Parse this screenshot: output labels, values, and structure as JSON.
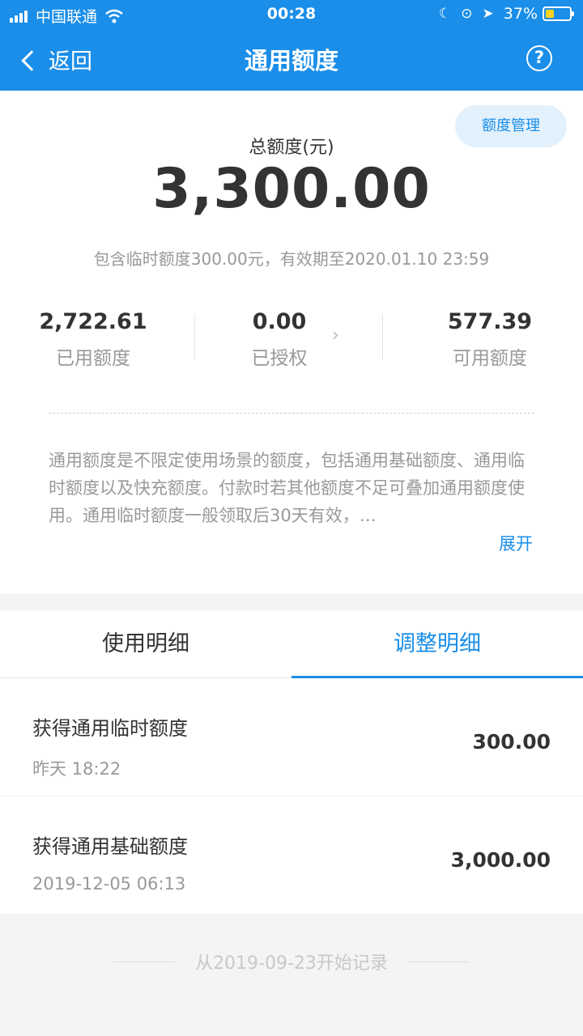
{
  "status": {
    "carrier": "中国联通",
    "time": "00:28",
    "battery": "37%",
    "colors": {
      "battery_fill": "#ffd21f"
    }
  },
  "nav": {
    "back_label": "返回",
    "title": "通用额度",
    "help_glyph": "?"
  },
  "summary": {
    "manage_label": "额度管理",
    "total_label": "总额度(元)",
    "total": "3,300.00",
    "note": "包含临时额度300.00元，有效期至2020.01.10 23:59",
    "stats": [
      {
        "value": "2,722.61",
        "label": "已用额度"
      },
      {
        "value": "0.00",
        "label": "已授权"
      },
      {
        "value": "577.39",
        "label": "可用额度"
      }
    ],
    "description": "通用额度是不限定使用场景的额度，包括通用基础额度、通用临时额度以及快充额度。付款时若其他额度不足可叠加通用额度使用。通用临时额度一般领取后30天有效，…",
    "expand_label": "展开"
  },
  "tabs": [
    {
      "label": "使用明细",
      "active": false
    },
    {
      "label": "调整明细",
      "active": true
    }
  ],
  "records": [
    {
      "title": "获得通用临时额度",
      "time": "昨天 18:22",
      "amount": "300.00"
    },
    {
      "title": "获得通用基础额度",
      "time": "2019-12-05 06:13",
      "amount": "3,000.00"
    }
  ],
  "footer": {
    "text": "从2019-09-23开始记录"
  },
  "colors": {
    "accent": "#1a8ee8",
    "background": "#f4f4f7"
  }
}
